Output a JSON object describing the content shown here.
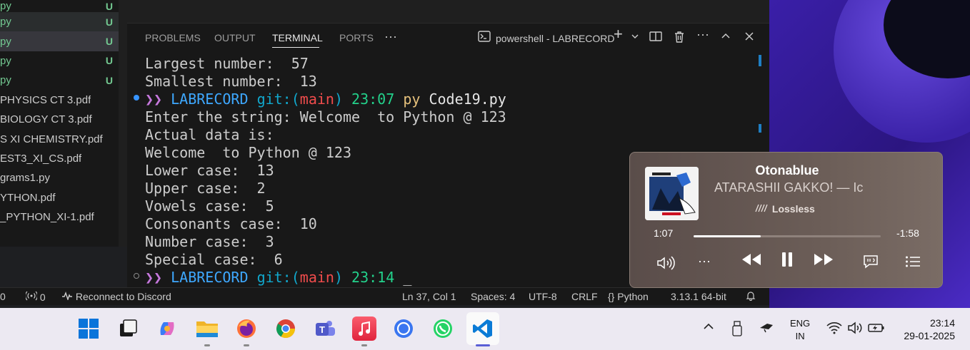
{
  "explorer": {
    "items": [
      {
        "label": "py",
        "type": "py",
        "badge": "U"
      },
      {
        "label": "py",
        "type": "py",
        "badge": "U"
      },
      {
        "label": "py",
        "type": "py",
        "badge": "U"
      },
      {
        "label": "py",
        "type": "py",
        "badge": "U"
      },
      {
        "label": "py",
        "type": "py",
        "badge": "U"
      },
      {
        "label": "PHYSICS CT 3.pdf",
        "type": "pdf",
        "badge": ""
      },
      {
        "label": "BIOLOGY  CT 3.pdf",
        "type": "pdf",
        "badge": ""
      },
      {
        "label": "S  XI CHEMISTRY.pdf",
        "type": "pdf",
        "badge": ""
      },
      {
        "label": "EST3_XI_CS.pdf",
        "type": "pdf",
        "badge": ""
      },
      {
        "label": "grams1.py",
        "type": "pdf",
        "badge": ""
      },
      {
        "label": "YTHON.pdf",
        "type": "pdf",
        "badge": ""
      },
      {
        "label": "_PYTHON_XI-1.pdf",
        "type": "pdf",
        "badge": ""
      }
    ]
  },
  "panel": {
    "tabs": [
      "PROBLEMS",
      "OUTPUT",
      "TERMINAL",
      "PORTS"
    ],
    "more": "···",
    "terminal_name": "powershell - LABRECORD"
  },
  "terminal": {
    "pre_lines": [
      "Largest number:  57",
      "Smallest number:  13"
    ],
    "prompt1": {
      "arrows": "❯❯",
      "dir": "LABRECORD",
      "git": "git:(",
      "branch": "main",
      "git_end": ")",
      "time": "23:07",
      "cmd": "py",
      "arg": "Code19.py"
    },
    "output_lines": [
      "Enter the string: Welcome  to Python @ 123",
      "Actual data is:",
      "Welcome  to Python @ 123",
      "Lower case:  13",
      "Upper case:  2",
      "Vowels case:  5",
      "Consonants case:  10",
      "Number case:  3",
      "Special case:  6"
    ],
    "prompt2": {
      "arrows": "❯❯",
      "dir": "LABRECORD",
      "git": "git:(",
      "branch": "main",
      "git_end": ")",
      "time": "23:14",
      "cursor": "_"
    }
  },
  "statusbar": {
    "errors": "0",
    "ports": "0",
    "discord": "Reconnect to Discord",
    "position": "Ln 37, Col 1",
    "spaces": "Spaces: 4",
    "encoding": "UTF-8",
    "eol": "CRLF",
    "language": "Python",
    "interpreter": "3.13.1 64-bit"
  },
  "player": {
    "song": "Otonablue",
    "artist": "ATARASHII GAKKO! — Ic",
    "quality": "Lossless",
    "elapsed": "1:07",
    "remaining": "-1:58",
    "progress": 0.36
  },
  "taskbar": {
    "language": "ENG",
    "region": "IN",
    "time": "23:14",
    "date": "29-01-2025"
  },
  "colors": {
    "accent": "#0078d4",
    "git_green": "#73c991"
  }
}
